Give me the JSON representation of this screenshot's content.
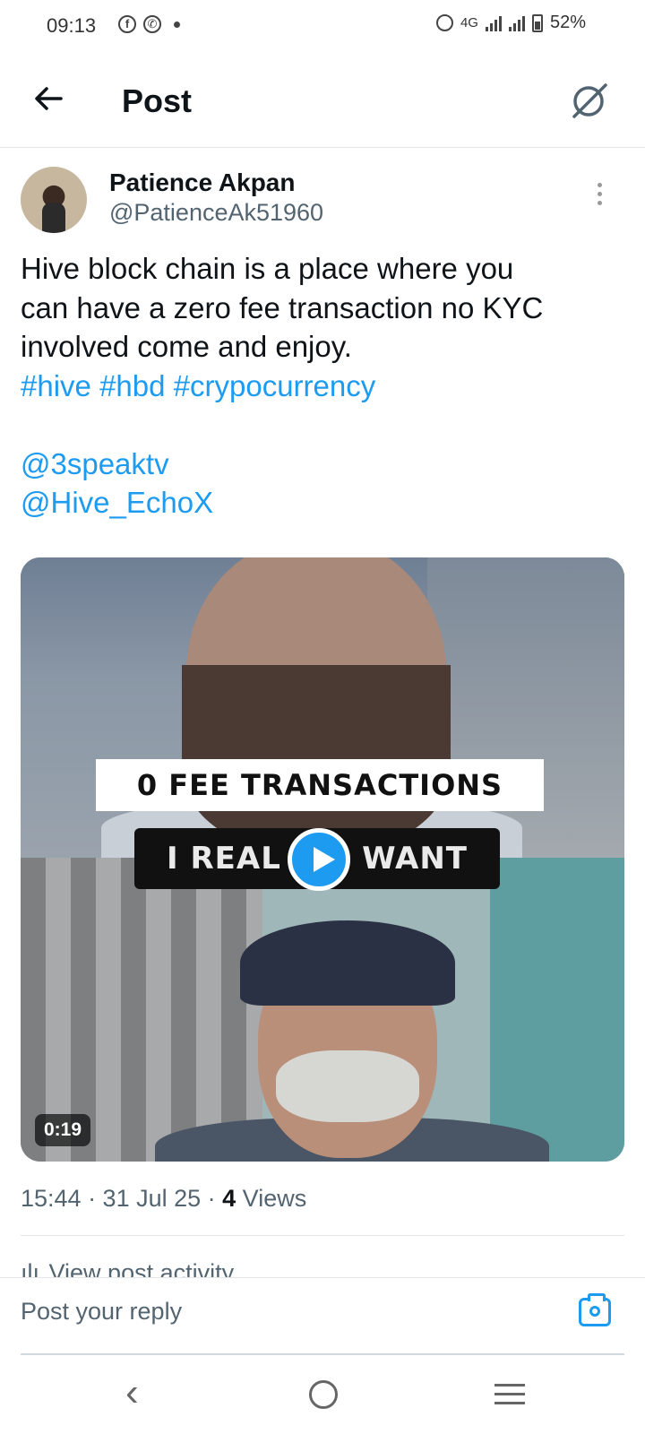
{
  "status_bar": {
    "time": "09:13",
    "network": "4G",
    "battery": "52%",
    "battery_level": 0.52
  },
  "header": {
    "title": "Post"
  },
  "post": {
    "author_name": "Patience Akpan",
    "author_handle": "@PatienceAk51960",
    "text_lines": [
      "Hive block chain is a place where you",
      "can have a zero fee transaction no KYC",
      "involved come and enjoy."
    ],
    "hashtags": [
      "#hive",
      "#hbd",
      "#crypocurrency"
    ],
    "mentions": [
      "@3speaktv",
      "@Hive_EchoX"
    ],
    "video": {
      "caption_top": "0 FEE TRANSACTIONS",
      "caption_bottom_left": "I REAL",
      "caption_bottom_right": "WANT",
      "duration": "0:19"
    },
    "timestamp": "15:44 · 31 Jul 25 · ",
    "views_count": "4",
    "views_label": " Views",
    "activity_label": "View post activity"
  },
  "reply": {
    "placeholder": "Post your reply"
  },
  "colors": {
    "accent": "#1d9bf0",
    "text": "#0f1419",
    "muted": "#536471"
  }
}
